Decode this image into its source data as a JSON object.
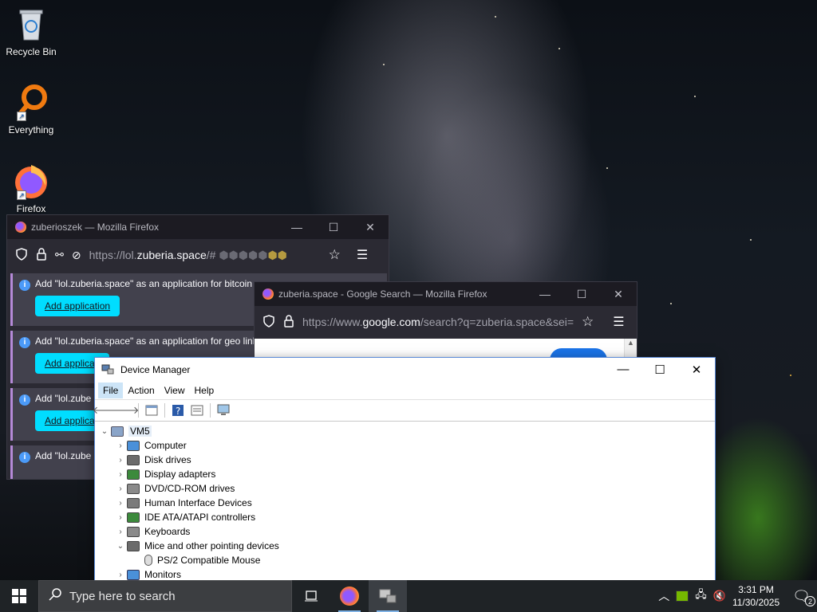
{
  "desktop": {
    "icons": [
      {
        "label": "Recycle Bin",
        "icon": "recycle-bin-icon"
      },
      {
        "label": "Everything",
        "icon": "everything-search-icon"
      },
      {
        "label": "Firefox",
        "icon": "firefox-icon"
      }
    ]
  },
  "firefox_window_1": {
    "title": "zuberioszek — Mozilla Firefox",
    "url_prefix": "https://lol.",
    "url_domain": "zuberia.space",
    "url_suffix": "/#",
    "notifications": [
      {
        "text": "Add \"lol.zuberia.space\" as an application for bitcoin",
        "button": "Add application"
      },
      {
        "text": "Add \"lol.zuberia.space\" as an application for geo link",
        "button": "Add applicati"
      },
      {
        "text": "Add \"lol.zube",
        "button": "Add applicati"
      },
      {
        "text": "Add \"lol.zube",
        "button": ""
      }
    ]
  },
  "firefox_window_2": {
    "title": "zuberia.space - Google Search — Mozilla Firefox",
    "url_prefix": "https://www.",
    "url_domain": "google.com",
    "url_suffix": "/search?q=zuberia.space&sei="
  },
  "device_manager": {
    "title": "Device Manager",
    "menu": [
      "File",
      "Action",
      "View",
      "Help"
    ],
    "root": "VM5",
    "items": [
      {
        "label": "Computer",
        "expanded": false,
        "color": "#4a90d9"
      },
      {
        "label": "Disk drives",
        "expanded": false,
        "color": "#6b6b6b"
      },
      {
        "label": "Display adapters",
        "expanded": false,
        "color": "#3c8a3c"
      },
      {
        "label": "DVD/CD-ROM drives",
        "expanded": false,
        "color": "#8a8a8a"
      },
      {
        "label": "Human Interface Devices",
        "expanded": false,
        "color": "#7a7a7a"
      },
      {
        "label": "IDE ATA/ATAPI controllers",
        "expanded": false,
        "color": "#3c8a3c"
      },
      {
        "label": "Keyboards",
        "expanded": false,
        "color": "#8a8a8a"
      },
      {
        "label": "Mice and other pointing devices",
        "expanded": true,
        "color": "#6b6b6b"
      }
    ],
    "child": "PS/2 Compatible Mouse",
    "last": "Monitors"
  },
  "taskbar": {
    "search_placeholder": "Type here to search",
    "time": "3:31 PM",
    "date": "11/30/2025",
    "notification_count": "2"
  }
}
